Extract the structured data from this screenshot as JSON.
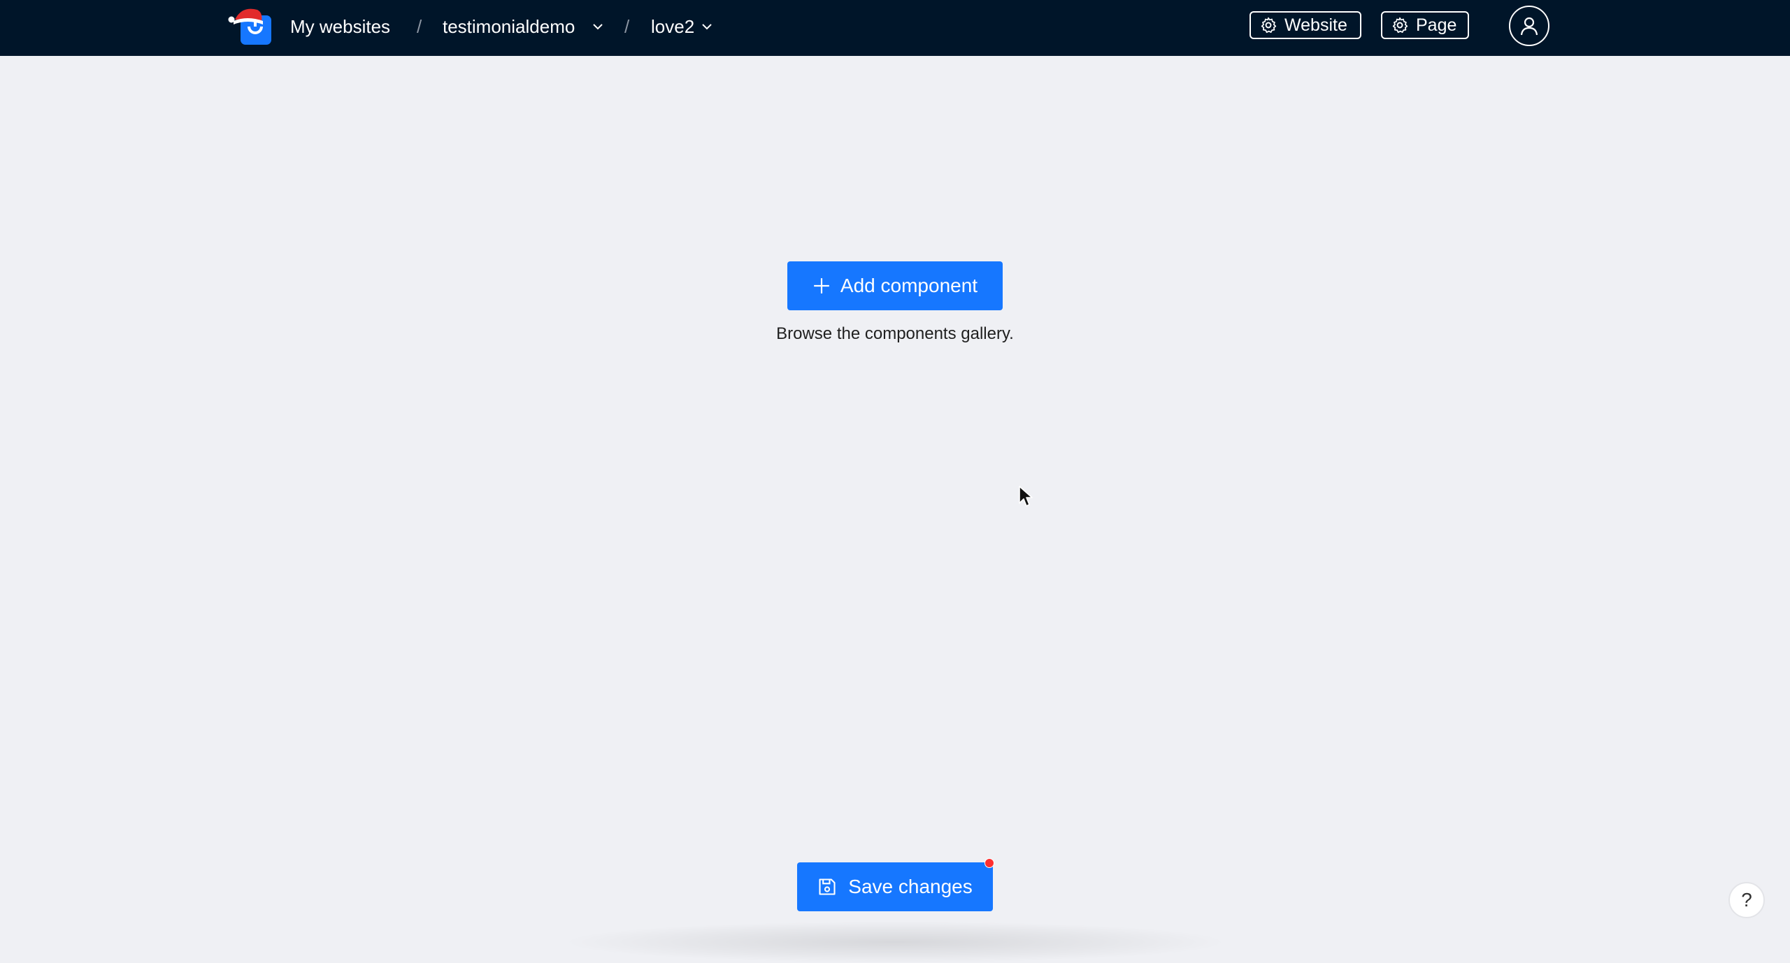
{
  "header": {
    "breadcrumb": {
      "home": "My websites",
      "separator": "/",
      "website": "testimonialdemo",
      "page": "love2"
    },
    "website_settings_label": "Website",
    "page_settings_label": "Page"
  },
  "main": {
    "add_component_label": "Add component",
    "hint": "Browse the components gallery."
  },
  "footer": {
    "save_label": "Save changes",
    "unsaved_indicator": true
  },
  "help": {
    "label": "?"
  },
  "icons": {
    "logo": "santa-hat-logo-icon",
    "gear": "gear-icon",
    "user": "user-icon",
    "plus": "plus-icon",
    "save": "save-icon",
    "chevron": "chevron-down-icon",
    "cursor": "mouse-cursor-icon"
  },
  "colors": {
    "topbar": "#001529",
    "background": "#eff0f4",
    "primary": "#1677ff",
    "unsaved_dot": "#ff2f2f"
  }
}
